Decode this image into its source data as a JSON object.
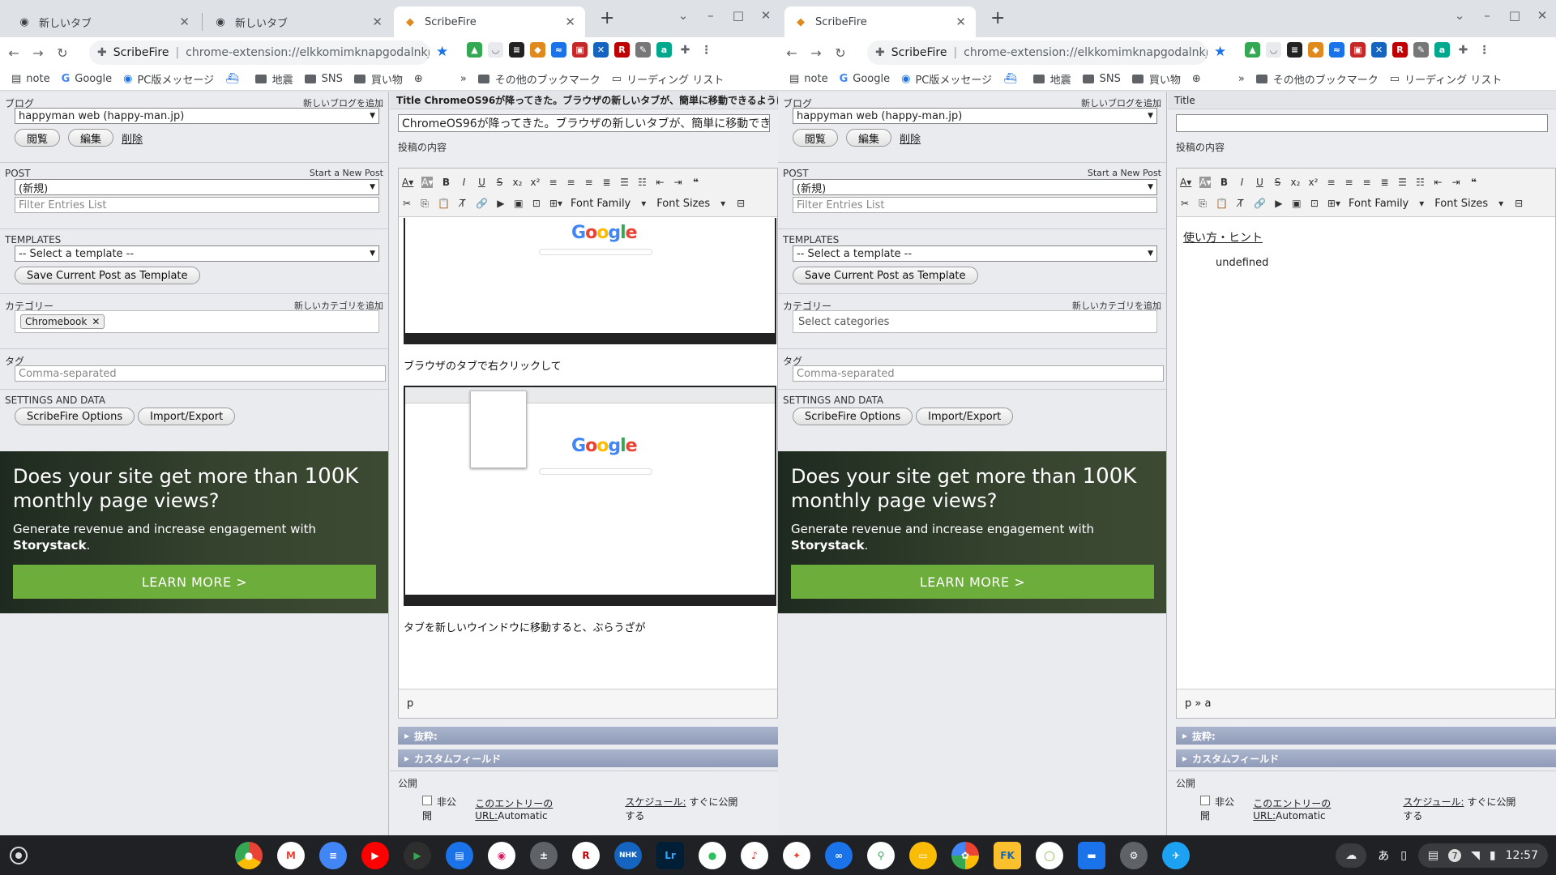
{
  "windows": {
    "left": {
      "tabs": [
        {
          "label": "新しいタブ"
        },
        {
          "label": "新しいタブ"
        },
        {
          "label": "ScribeFire"
        }
      ],
      "omnibox": {
        "site": "ScribeFire",
        "url": "chrome-extension://elkkomimknapgodalnkjeddk..."
      },
      "title_bar": "Title ChromeOS96が降ってきた。ブラウザの新しいタブが、簡単に移動できるようにな",
      "title_value": "ChromeOS96が降ってきた。ブラウザの新しいタブが、簡単に移動できるよう",
      "category_chip": "Chromebook",
      "editor_text_1": "ブラウザのタブで右クリックして",
      "editor_text_2": "タブを新しいウインドウに移動すると、ぶらうざが",
      "editor_path": "p"
    },
    "right": {
      "tabs": [
        {
          "label": "ScribeFire"
        }
      ],
      "omnibox": {
        "site": "ScribeFire",
        "url": "chrome-extension://elkkomimknapgodalnkjeddk..."
      },
      "title_bar": "Title",
      "title_value": "",
      "category_placeholder": "Select categories",
      "editor_link": "使い方・ヒント",
      "editor_text": "undefined",
      "editor_path": "p » a"
    }
  },
  "bookmarks": [
    {
      "label": "note",
      "icon": "note-icon"
    },
    {
      "label": "Google",
      "icon": "google-icon"
    },
    {
      "label": "PC版メッセージ",
      "icon": "message-icon"
    },
    {
      "label": "",
      "icon": "ship-icon"
    },
    {
      "label": "地震",
      "icon": "folder-icon"
    },
    {
      "label": "SNS",
      "icon": "folder-icon"
    },
    {
      "label": "買い物",
      "icon": "folder-icon"
    },
    {
      "label": "",
      "icon": "globe-icon"
    }
  ],
  "bookmarks_more": "»",
  "other_bookmarks": "その他のブックマーク",
  "reading_list": "リーディング リスト",
  "sidebar": {
    "blog_label": "ブログ",
    "add_blog": "新しいブログを追加",
    "blog_value": "happyman web (happy-man.jp)",
    "view": "閲覧",
    "edit": "編集",
    "delete": "削除",
    "post_label": "POST",
    "start_new_post": "Start a New Post",
    "post_value": "(新規)",
    "filter_placeholder": "Filter Entries List",
    "templates_label": "TEMPLATES",
    "template_value": "-- Select a template --",
    "save_template": "Save Current Post as Template",
    "category_label": "カテゴリー",
    "add_category": "新しいカテゴリを追加",
    "tag_label": "タグ",
    "tag_placeholder": "Comma-separated",
    "settings_label": "SETTINGS AND DATA",
    "options": "ScribeFire Options",
    "import_export": "Import/Export"
  },
  "ad": {
    "headline_pre": "Does your site get more than ",
    "headline_big": "100K",
    "headline_post": " monthly page views?",
    "body_pre": "Generate revenue and increase engagement with ",
    "body_brand": "Storystack",
    "body_post": ".",
    "cta": "LEARN MORE >"
  },
  "editor": {
    "content_label": "投稿の内容",
    "font_family": "Font Family",
    "font_sizes": "Font Sizes",
    "excerpt": "抜粋:",
    "custom_fields": "カスタムフィールド",
    "publish_label": "公開",
    "private": "非公開",
    "entry_url_label": "このエントリーのURL:",
    "entry_url_value": "Automatic",
    "schedule_label": "スケジュール:",
    "schedule_value": "すぐに公開する"
  },
  "shelf": {
    "apps": [
      "chrome",
      "gmail",
      "docs",
      "youtube",
      "play",
      "messages",
      "wifi-app",
      "calculator",
      "rakuten",
      "nhk",
      "lightroom",
      "evernote",
      "music",
      "pinwheel",
      "infinity",
      "maps",
      "keep",
      "photos",
      "fk",
      "circle",
      "files",
      "settings",
      "twitter"
    ],
    "ime": "あ",
    "notif_count": "7",
    "time": "12:57"
  },
  "colors": {
    "accent": "#1a73e8",
    "ad_cta": "#6cad3b",
    "collapsible": "#95a1bd"
  }
}
